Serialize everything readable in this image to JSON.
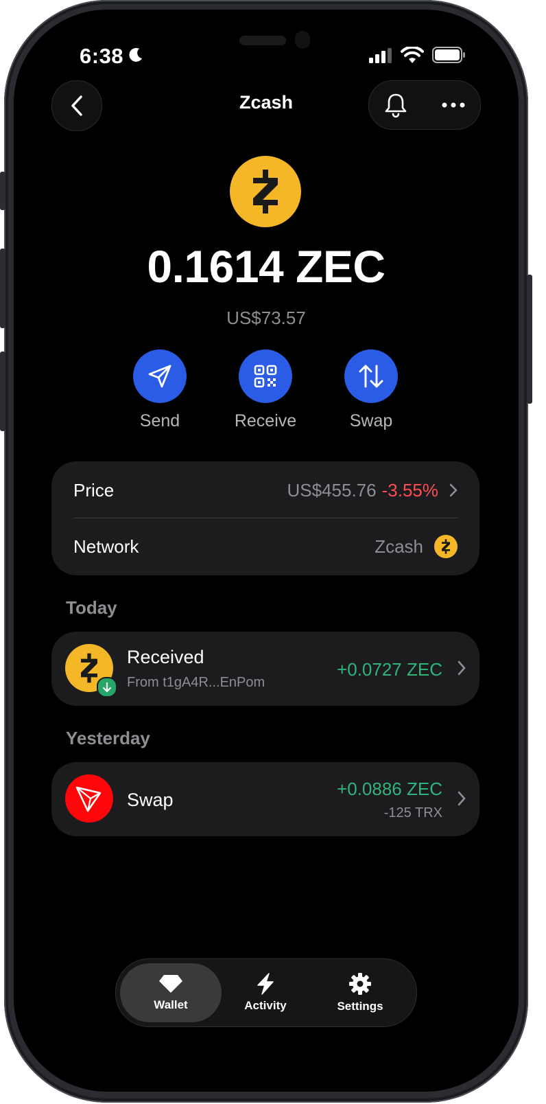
{
  "status_bar": {
    "time": "6:38"
  },
  "header": {
    "title": "Zcash"
  },
  "asset": {
    "balance": "0.1614 ZEC",
    "fiat_value": "US$73.57",
    "brand_color": "#f4b728"
  },
  "actions": [
    {
      "label": "Send",
      "icon": "send-icon"
    },
    {
      "label": "Receive",
      "icon": "qr-code-icon"
    },
    {
      "label": "Swap",
      "icon": "swap-arrows-icon"
    }
  ],
  "info": {
    "price_label": "Price",
    "price_value": "US$455.76",
    "price_change": "-3.55%",
    "network_label": "Network",
    "network_value": "Zcash"
  },
  "sections": {
    "today": "Today",
    "yesterday": "Yesterday"
  },
  "transactions": [
    {
      "title": "Received",
      "subtitle": "From t1gA4R...EnPom",
      "amount": "+0.0727 ZEC",
      "icon": "zcash-icon"
    },
    {
      "title": "Swap",
      "amount": "+0.0886 ZEC",
      "secondary_amount": "-125 TRX",
      "icon": "tron-icon"
    }
  ],
  "tabs": [
    {
      "label": "Wallet",
      "icon": "gem-icon",
      "active": true
    },
    {
      "label": "Activity",
      "icon": "lightning-icon",
      "active": false
    },
    {
      "label": "Settings",
      "icon": "gear-icon",
      "active": false
    }
  ],
  "colors": {
    "accent": "#2b5ce6",
    "positive": "#2fb47c",
    "negative": "#ff4d4f",
    "card": "#1c1c1e"
  }
}
